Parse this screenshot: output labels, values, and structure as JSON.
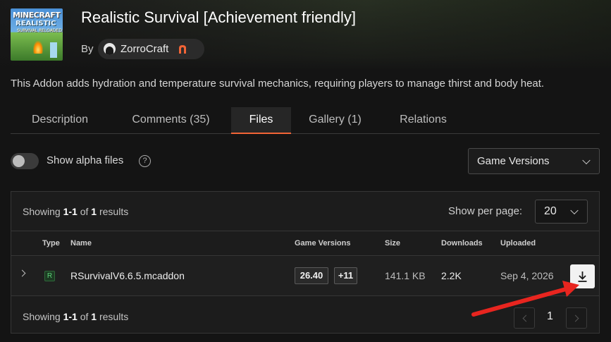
{
  "project": {
    "title": "Realistic Survival [Achievement friendly]",
    "by_label": "By",
    "author": "ZorroCraft",
    "description": "This Addon adds hydration and temperature survival mechanics, requiring players to manage thirst and body heat.",
    "logo_text": [
      "MINECRAFT",
      "REALISTIC",
      "SURVIVAL RELOADED"
    ]
  },
  "tabs": [
    {
      "label": "Description",
      "active": false
    },
    {
      "label": "Comments (35)",
      "active": false
    },
    {
      "label": "Files",
      "active": true
    },
    {
      "label": "Gallery (1)",
      "active": false
    },
    {
      "label": "Relations",
      "active": false
    }
  ],
  "filters": {
    "alpha_toggle_label": "Show alpha files",
    "alpha_toggle_on": false,
    "help_icon": "?",
    "game_versions_label": "Game Versions"
  },
  "results": {
    "showing_prefix": "Showing",
    "range": "1-1",
    "of": "of",
    "total": "1",
    "suffix": "results",
    "per_page_label": "Show per page:",
    "per_page_value": "20"
  },
  "table": {
    "headers": {
      "type": "Type",
      "name": "Name",
      "game_versions": "Game Versions",
      "size": "Size",
      "downloads": "Downloads",
      "uploaded": "Uploaded"
    },
    "rows": [
      {
        "type": "R",
        "name": "RSurvivalV6.6.5.mcaddon",
        "version": "26.40",
        "more_versions": "+11",
        "size": "141.1 KB",
        "downloads": "2.2K",
        "uploaded": "Sep 4, 2026"
      }
    ]
  },
  "pagination": {
    "current_page": "1"
  },
  "colors": {
    "accent": "#f16436",
    "annotation_arrow": "#e8251f",
    "background": "#141414"
  },
  "icons": [
    "chevron-down-icon",
    "help-icon",
    "download-icon",
    "chevron-left-icon",
    "chevron-right-icon",
    "expand-chevron-icon",
    "anvil-icon"
  ]
}
